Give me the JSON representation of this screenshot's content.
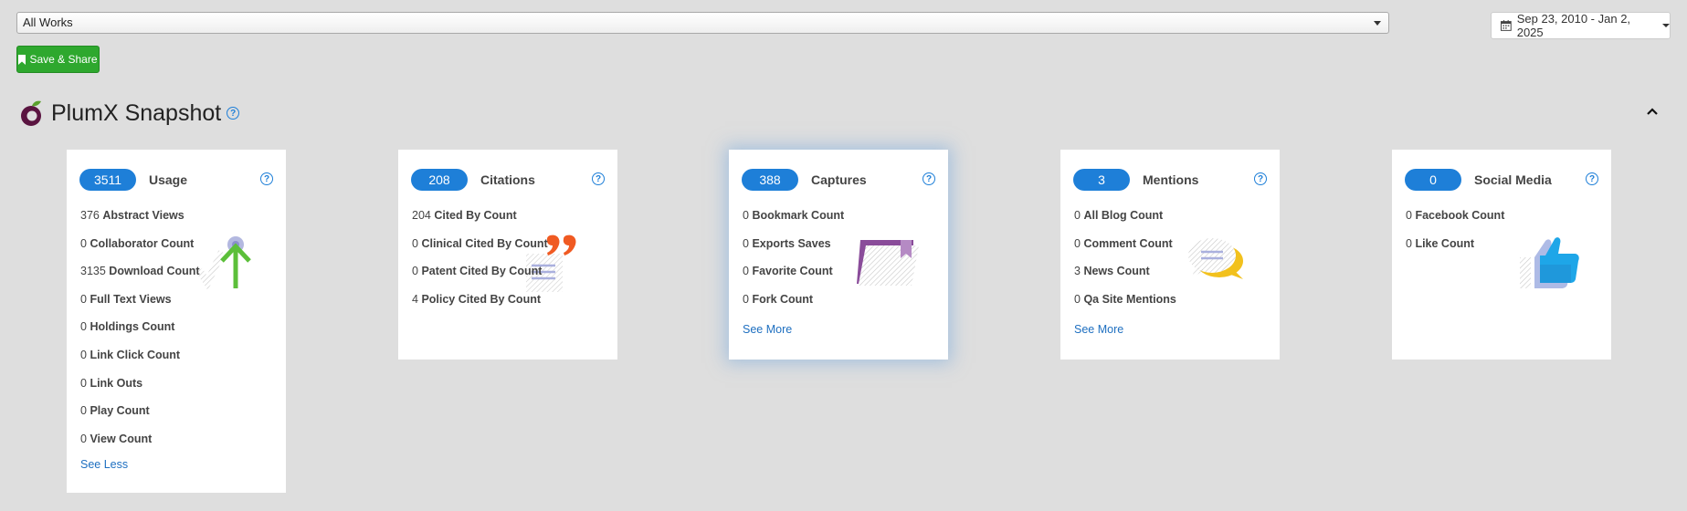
{
  "filters": {
    "works_select_value": "All Works",
    "date_range": "Sep 23, 2010 - Jan 2, 2025"
  },
  "toolbar": {
    "save_share_label": "Save & Share"
  },
  "header": {
    "title": "PlumX Snapshot",
    "help_icon": "?"
  },
  "cards": [
    {
      "count": "3511",
      "title": "Usage",
      "icon": "usage-arrow-icon",
      "items": [
        {
          "n": "376",
          "label": "Abstract Views"
        },
        {
          "n": "0",
          "label": "Collaborator Count"
        },
        {
          "n": "3135",
          "label": "Download Count"
        },
        {
          "n": "0",
          "label": "Full Text Views"
        },
        {
          "n": "0",
          "label": "Holdings Count"
        },
        {
          "n": "0",
          "label": "Link Click Count"
        },
        {
          "n": "0",
          "label": "Link Outs"
        },
        {
          "n": "0",
          "label": "Play Count"
        },
        {
          "n": "0",
          "label": "View Count"
        }
      ],
      "link": "See Less"
    },
    {
      "count": "208",
      "title": "Citations",
      "icon": "quote-icon",
      "items": [
        {
          "n": "204",
          "label": "Cited By Count"
        },
        {
          "n": "0",
          "label": "Clinical Cited By Count"
        },
        {
          "n": "0",
          "label": "Patent Cited By Count"
        },
        {
          "n": "4",
          "label": "Policy Cited By Count"
        }
      ],
      "link": ""
    },
    {
      "count": "388",
      "title": "Captures",
      "icon": "bookmark-folder-icon",
      "items": [
        {
          "n": "0",
          "label": "Bookmark Count"
        },
        {
          "n": "0",
          "label": "Exports Saves"
        },
        {
          "n": "0",
          "label": "Favorite Count"
        },
        {
          "n": "0",
          "label": "Fork Count"
        }
      ],
      "link": "See More"
    },
    {
      "count": "3",
      "title": "Mentions",
      "icon": "speech-bubble-icon",
      "items": [
        {
          "n": "0",
          "label": "All Blog Count"
        },
        {
          "n": "0",
          "label": "Comment Count"
        },
        {
          "n": "3",
          "label": "News Count"
        },
        {
          "n": "0",
          "label": "Qa Site Mentions"
        }
      ],
      "link": "See More"
    },
    {
      "count": "0",
      "title": "Social Media",
      "icon": "thumbs-up-icon",
      "items": [
        {
          "n": "0",
          "label": "Facebook Count"
        },
        {
          "n": "0",
          "label": "Like Count"
        }
      ],
      "link": ""
    }
  ],
  "colors": {
    "accent": "#1e7fd8",
    "save_green": "#2ea82e",
    "background": "#dedede"
  }
}
